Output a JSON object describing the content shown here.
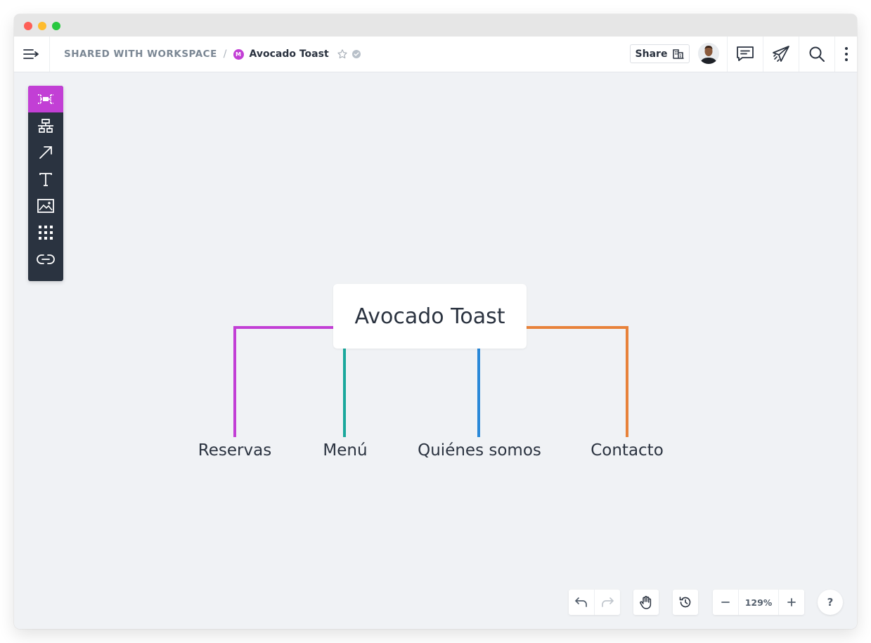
{
  "header": {
    "breadcrumb_root": "SHARED WITH WORKSPACE",
    "breadcrumb_separator": "/",
    "workspace_badge": "M",
    "document_title": "Avocado Toast",
    "share_label": "Share"
  },
  "toolbar": {
    "tools": [
      {
        "name": "mind-map-tool",
        "icon": "mindmap-icon",
        "active": true
      },
      {
        "name": "org-chart-tool",
        "icon": "org-chart-icon",
        "active": false
      },
      {
        "name": "arrow-tool",
        "icon": "arrow-icon",
        "active": false
      },
      {
        "name": "text-tool",
        "icon": "text-icon",
        "active": false
      },
      {
        "name": "image-tool",
        "icon": "image-icon",
        "active": false
      },
      {
        "name": "grid-tool",
        "icon": "grid-icon",
        "active": false
      },
      {
        "name": "link-tool",
        "icon": "link-icon",
        "active": false
      }
    ]
  },
  "mindmap": {
    "root": "Avocado Toast",
    "branches": [
      {
        "label": "Reservas",
        "color": "#c23fd5"
      },
      {
        "label": "Menú",
        "color": "#1aa89c"
      },
      {
        "label": "Quiénes somos",
        "color": "#2a88d8"
      },
      {
        "label": "Contacto",
        "color": "#e8823a"
      }
    ]
  },
  "footer": {
    "zoom": "129%",
    "help": "?"
  },
  "colors": {
    "accent": "#c23fd5",
    "toolbar_bg": "#2a3340",
    "canvas_bg": "#f0f2f5"
  }
}
